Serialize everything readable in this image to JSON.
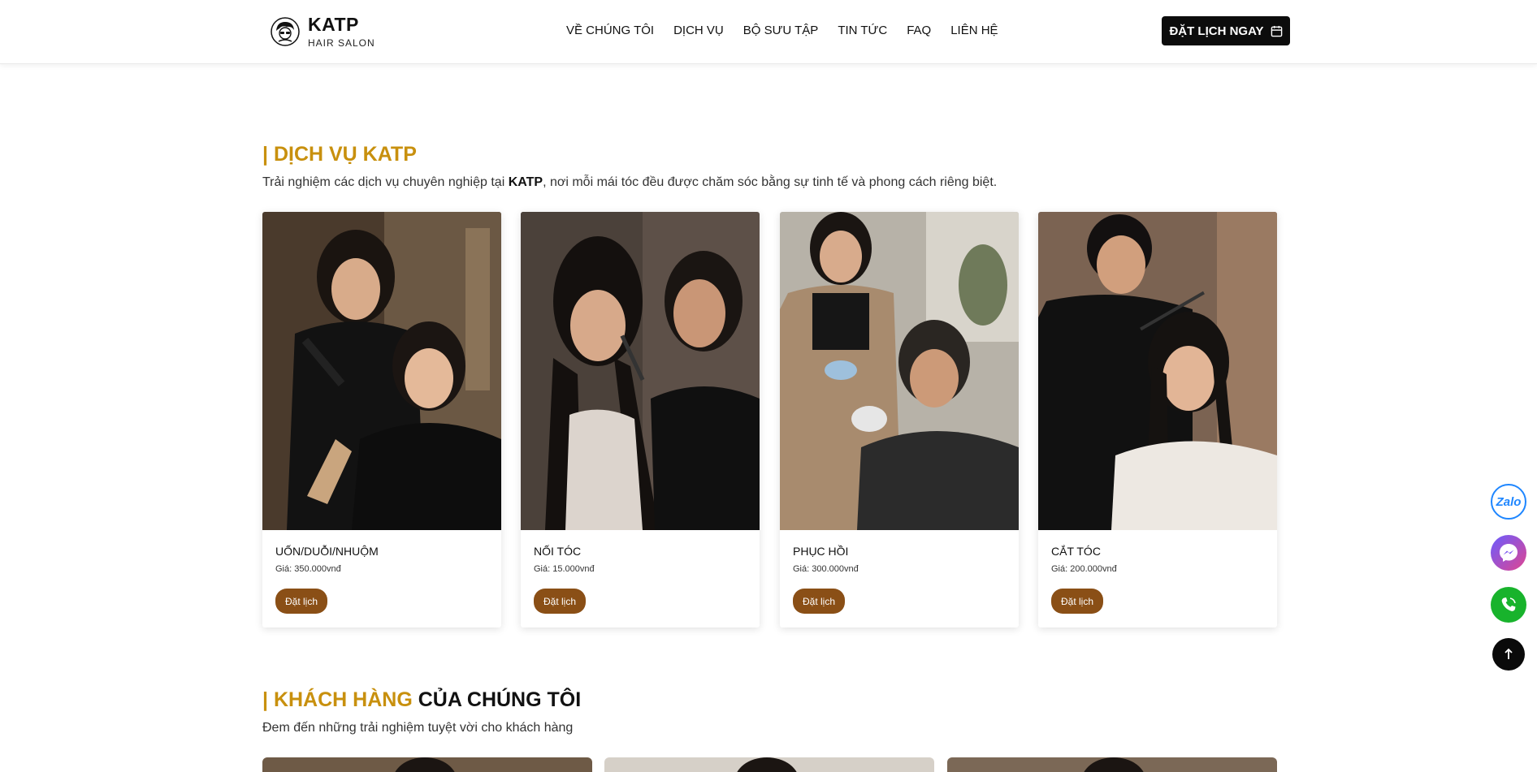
{
  "header": {
    "brand": "KATP",
    "tagline": "HAIR SALON",
    "nav": [
      "VỀ CHÚNG TÔI",
      "DỊCH VỤ",
      "BỘ SƯU TẬP",
      "TIN TỨC",
      "FAQ",
      "LIÊN HỆ"
    ],
    "cta_label": "ĐẶT LỊCH NGAY"
  },
  "services": {
    "title_accent": "| DỊCH VỤ KATP",
    "description_pre": "Trải nghiệm các dịch vụ chuyên nghiệp tại ",
    "description_brand": "KATP",
    "description_post": ", nơi mỗi mái tóc đều được chăm sóc bằng sự tinh tế và phong cách riêng biệt.",
    "cards": [
      {
        "name": "UỐN/DUỖI/NHUỘM",
        "price": "Giá: 350.000vnđ",
        "button": "Đặt lịch"
      },
      {
        "name": "NỐI TÓC",
        "price": "Giá: 15.000vnđ",
        "button": "Đặt lịch"
      },
      {
        "name": "PHỤC HỒI",
        "price": "Giá: 300.000vnđ",
        "button": "Đặt lịch"
      },
      {
        "name": "CẮT TÓC",
        "price": "Giá: 200.000vnđ",
        "button": "Đặt lịch"
      }
    ]
  },
  "customers": {
    "title_accent": "| KHÁCH HÀNG",
    "title_rest": " CỦA CHÚNG TÔI",
    "description": "Đem đến những trải nghiệm tuyệt vời cho khách hàng"
  },
  "contacts": {
    "zalo_label": "Zalo"
  },
  "colors": {
    "accent": "#c8900e",
    "button_brown": "#8a4f16",
    "cta_dark": "#0c0c0c"
  }
}
